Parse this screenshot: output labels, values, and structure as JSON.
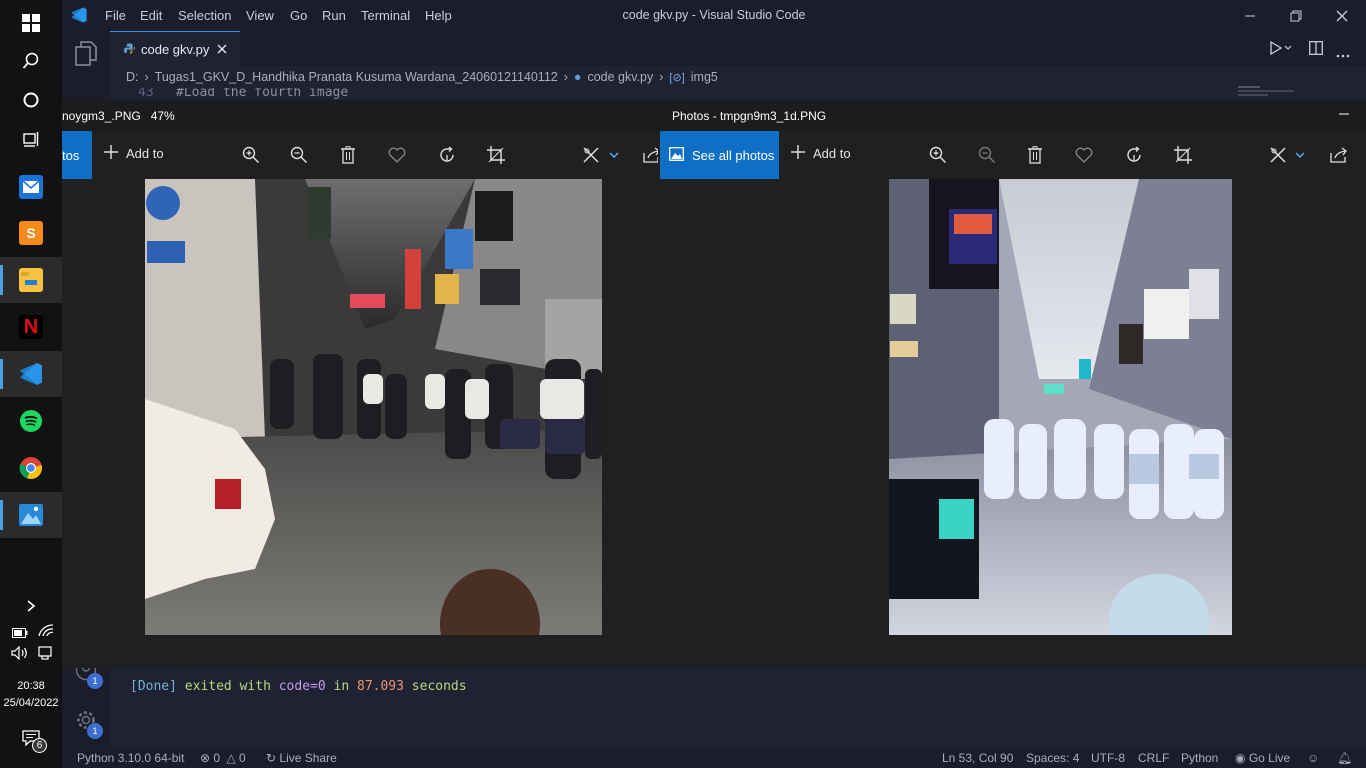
{
  "taskbar": {
    "icons": [
      "windows-start-icon",
      "search-icon",
      "cortana-icon",
      "task-view-icon",
      "mail-icon",
      "sublime-text-icon",
      "file-explorer-icon",
      "netflix-icon",
      "vscode-icon",
      "spotify-icon",
      "chrome-icon",
      "photos-icon"
    ],
    "time": "20:38",
    "date": "25/04/2022",
    "notification_count": "6"
  },
  "vscode": {
    "menu": [
      "File",
      "Edit",
      "Selection",
      "View",
      "Go",
      "Run",
      "Terminal",
      "Help"
    ],
    "window_title": "code gkv.py - Visual Studio Code",
    "tab_label": "code gkv.py",
    "breadcrumb": {
      "drive": "D:",
      "folder": "Tugas1_GKV_D_Handhika Pranata Kusuma Wardana_24060121140112",
      "file": "code gkv.py",
      "symbol": "img5"
    },
    "code": {
      "line_number": "43",
      "text": "#Load the fourth image"
    },
    "badges": {
      "accounts": "1",
      "settings": "1"
    },
    "terminal": {
      "done": "[Done]",
      "exited_with": "exited with",
      "code": "code=0",
      "in": "in",
      "seconds": "87.093",
      "seconds_label": "seconds"
    },
    "status": {
      "python": "Python 3.10.0 64-bit",
      "errors": "0",
      "warnings": "0",
      "live_share": "Live Share",
      "position": "Ln 53, Col 90",
      "spaces": "Spaces: 4",
      "encoding": "UTF-8",
      "eol": "CRLF",
      "language": "Python",
      "go_live": "Go Live"
    }
  },
  "photos_left": {
    "title": "noygm3_.PNG",
    "zoom": "47%",
    "see_all_partial": "tos",
    "add_to": "Add to"
  },
  "photos_right": {
    "title": "Photos - tmpgn9m3_1d.PNG",
    "see_all": "See all photos",
    "add_to": "Add to"
  },
  "colors": {
    "accent": "#0f6fc6",
    "terminal_done": "#6fb3d2",
    "terminal_green": "#b7d97a",
    "terminal_num": "#f0946c"
  }
}
